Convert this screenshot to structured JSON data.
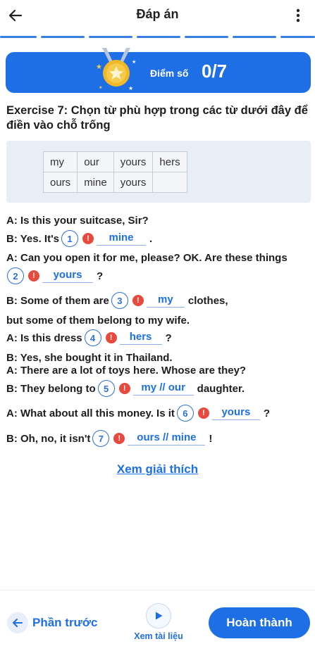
{
  "header": {
    "title": "Đáp án",
    "back_icon": "arrow-left-icon",
    "menu_icon": "more-vertical-icon"
  },
  "progress": {
    "segments": 8,
    "completed": 8,
    "color": "#3a7de3"
  },
  "score": {
    "label": "Điểm số",
    "value": "0/7",
    "medal_icon": "medal-star-icon",
    "card_color": "#1e6fe6"
  },
  "exercise": {
    "title": "Exercise 7: Chọn từ phù hợp trong các từ dưới đây để điền vào chỗ trống",
    "word_bank": [
      [
        "my",
        "our",
        "yours",
        "hers"
      ],
      [
        "ours",
        "mine",
        "yours",
        ""
      ]
    ]
  },
  "dialogue": {
    "l1": "A: Is this your suitcase, Sir?",
    "q1": {
      "pre": "B: Yes. It's",
      "num": "1",
      "answer": "mine",
      "post": "."
    },
    "l2": "A: Can you open it for me, please? OK. Are these things",
    "q2": {
      "num": "2",
      "answer": "yours",
      "post": "?"
    },
    "q3": {
      "pre": "B: Some of them are",
      "num": "3",
      "answer": "my",
      "post": "clothes,"
    },
    "l3": "but some of them belong to my wife.",
    "q4": {
      "pre": "A: Is this dress",
      "num": "4",
      "answer": "hers",
      "post": "?"
    },
    "l4": "B: Yes, she bought it in Thailand.",
    "l5": "A: There are a lot of toys here. Whose are they?",
    "q5": {
      "pre": "B: They belong to",
      "num": "5",
      "answer": "my // our",
      "post": "daughter."
    },
    "q6": {
      "pre": "A: What about all this money. Is it",
      "num": "6",
      "answer": "yours",
      "post": "?"
    },
    "q7": {
      "pre": "B: Oh, no, it isn't",
      "num": "7",
      "answer": "ours // mine",
      "post": "!"
    },
    "wrong_mark": "!",
    "wrong_color": "#e9493d"
  },
  "explain_link": "Xem giải thích",
  "footer": {
    "prev_label": "Phần trước",
    "doc_label": "Xem tài liệu",
    "done_label": "Hoàn thành",
    "play_icon": "play-icon"
  }
}
